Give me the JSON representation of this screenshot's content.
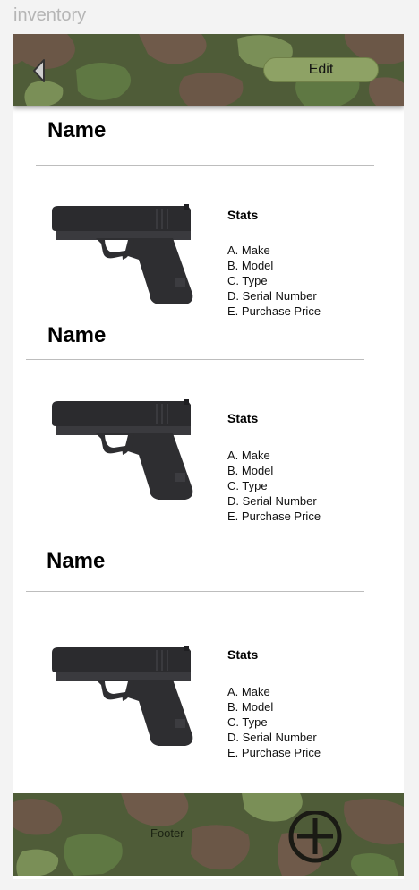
{
  "frame_label": "inventory",
  "header": {
    "back_icon": "back-arrow-icon",
    "edit_label": "Edit",
    "camo_colors": [
      "#4f5c38",
      "#6f5a4a",
      "#5f7843",
      "#7a8f57"
    ]
  },
  "items": [
    {
      "name": "Name",
      "stats_title": "Stats",
      "stats": [
        "A. Make",
        "B. Model",
        "C. Type",
        "D. Serial Number",
        "E. Purchase Price"
      ]
    },
    {
      "name": "Name",
      "stats_title": "Stats",
      "stats": [
        "A. Make",
        "B. Model",
        "C. Type",
        "D. Serial Number",
        "E. Purchase Price"
      ]
    },
    {
      "name": "Name",
      "stats_title": "Stats",
      "stats": [
        "A. Make",
        "B. Model",
        "C. Type",
        "D. Serial Number",
        "E. Purchase Price"
      ]
    }
  ],
  "footer": {
    "label": "Footer",
    "add_icon": "plus-circle-icon"
  }
}
